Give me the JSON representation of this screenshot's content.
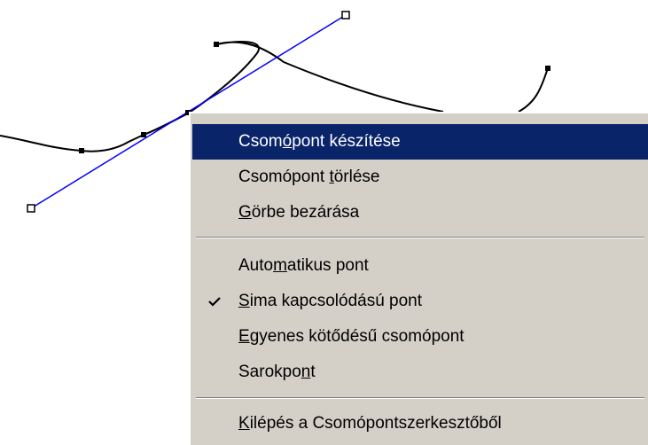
{
  "context_menu": {
    "items": [
      {
        "name": "menu-item-add-node",
        "label": "Csomópont készítése",
        "mnemonic_index": 4,
        "highlighted": true,
        "checked": false
      },
      {
        "name": "menu-item-delete-node",
        "label": "Csomópont törlése",
        "mnemonic_index": 10,
        "highlighted": false,
        "checked": false
      },
      {
        "name": "menu-item-close-curve",
        "label": "Görbe bezárása",
        "mnemonic_index": 0,
        "highlighted": false,
        "checked": false
      },
      {
        "name": "menu-item-auto-point",
        "label": "Automatikus pont",
        "mnemonic_index": 4,
        "highlighted": false,
        "checked": false
      },
      {
        "name": "menu-item-smooth-point",
        "label": "Sima kapcsolódású pont",
        "mnemonic_index": 0,
        "highlighted": false,
        "checked": true
      },
      {
        "name": "menu-item-straight-point",
        "label": "Egyenes kötődésű csomópont",
        "mnemonic_index": 0,
        "highlighted": false,
        "checked": false
      },
      {
        "name": "menu-item-corner-point",
        "label": "Sarokpont",
        "mnemonic_index": 7,
        "highlighted": false,
        "checked": false
      },
      {
        "name": "menu-item-exit-node-editor",
        "label": "Kilépés a Csomópontszerkesztőből",
        "mnemonic_index": 0,
        "highlighted": false,
        "checked": false
      }
    ]
  },
  "colors": {
    "menu_background": "#d4d0c8",
    "highlight": "#0a246a",
    "tangent_line": "#0000ff",
    "curve": "#000000"
  }
}
